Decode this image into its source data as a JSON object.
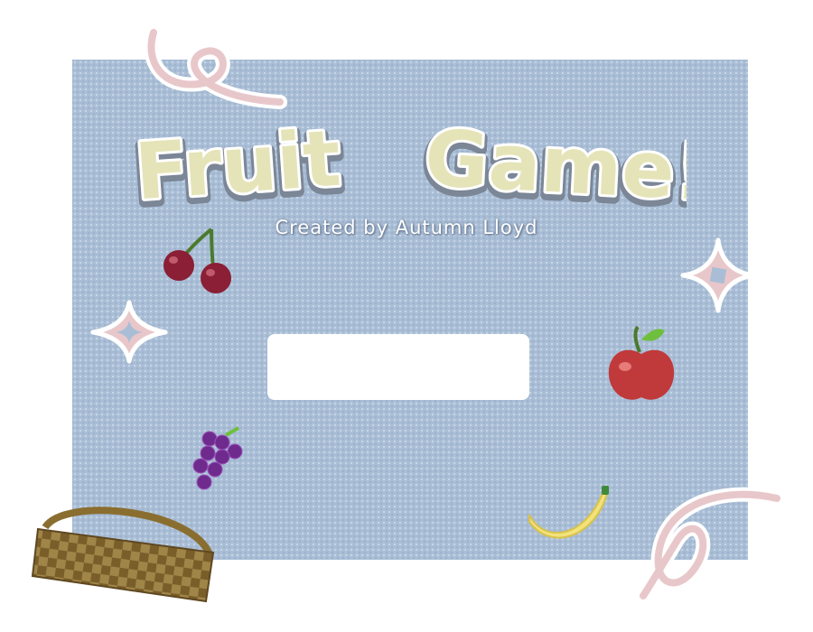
{
  "game": {
    "title": "Fruit Game!",
    "title_word_1": "Fruit",
    "title_word_2": "Game!",
    "subtitle": "Created by Autumn Lloyd",
    "start_button_label": ""
  },
  "colors": {
    "background": "#a9bed6",
    "title_fill": "#e5e4b8",
    "title_outline": "#ffffff",
    "title_shadow": "#7b8696",
    "decoration_pink": "#e8c7cb",
    "button": "#ffffff"
  },
  "sprites": [
    "cherries-icon",
    "apple-icon",
    "grapes-icon",
    "banana-icon",
    "basket-icon",
    "sparkle-icon",
    "swirl-icon"
  ]
}
